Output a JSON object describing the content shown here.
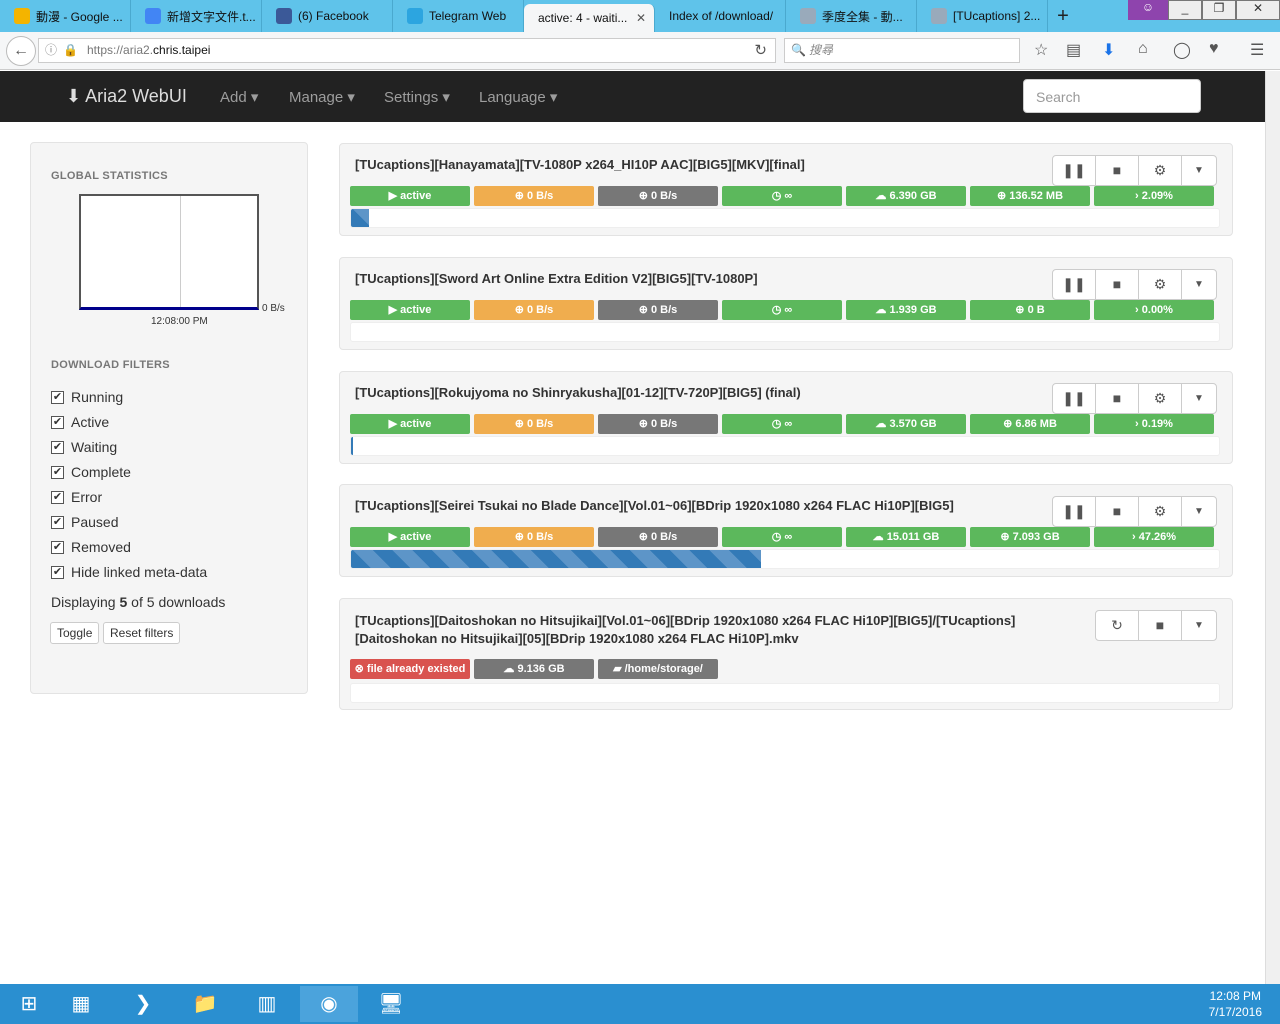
{
  "browser": {
    "tabs": [
      {
        "label": "動漫 - Google ...",
        "color": "#f4b400"
      },
      {
        "label": "新增文字文件.t...",
        "color": "#4285f4"
      },
      {
        "label": "(6) Facebook",
        "color": "#3b5998"
      },
      {
        "label": "Telegram Web",
        "color": "#2ca5e0"
      },
      {
        "label": "active: 4 - waiti...",
        "color": ""
      },
      {
        "label": "Index of /download/",
        "color": ""
      },
      {
        "label": "季度全集 - 動...",
        "color": "#9ab"
      },
      {
        "label": "[TUcaptions] 2...",
        "color": "#9ab"
      }
    ],
    "url_prefix": "https://aria2.",
    "url_domain": "chris.taipei",
    "search_placeholder": "搜尋"
  },
  "nav": {
    "brand": "Aria2 WebUI",
    "menus": [
      "Add",
      "Manage",
      "Settings",
      "Language"
    ],
    "search_placeholder": "Search"
  },
  "sidebar": {
    "stats_title": "GLOBAL STATISTICS",
    "graph_speed": "0 B/s",
    "graph_time": "12:08:00 PM",
    "filters_title": "DOWNLOAD FILTERS",
    "filters": [
      "Running",
      "Active",
      "Waiting",
      "Complete",
      "Error",
      "Paused",
      "Removed",
      "Hide linked meta-data"
    ],
    "display_pre": "Displaying",
    "display_count": "5",
    "display_mid": "of",
    "display_total": "5",
    "display_post": "downloads",
    "toggle": "Toggle",
    "reset": "Reset filters"
  },
  "downloads": [
    {
      "name": "[TUcaptions][Hanayamata][TV-1080P x264_HI10P AAC][BIG5][MKV][final]",
      "status": "active",
      "down": "0 B/s",
      "up": "0 B/s",
      "eta": "∞",
      "size": "6.390 GB",
      "downloaded": "136.52 MB",
      "percent": "2.09%",
      "progress": 2.09
    },
    {
      "name": "[TUcaptions][Sword Art Online Extra Edition V2][BIG5][TV-1080P]",
      "status": "active",
      "down": "0 B/s",
      "up": "0 B/s",
      "eta": "∞",
      "size": "1.939 GB",
      "downloaded": "0 B",
      "percent": "0.00%",
      "progress": 0
    },
    {
      "name": "[TUcaptions][Rokujyoma no Shinryakusha][01-12][TV-720P][BIG5] (final)",
      "status": "active",
      "down": "0 B/s",
      "up": "0 B/s",
      "eta": "∞",
      "size": "3.570 GB",
      "downloaded": "6.86 MB",
      "percent": "0.19%",
      "progress": 0.19
    },
    {
      "name": "[TUcaptions][Seirei Tsukai no Blade Dance][Vol.01~06][BDrip 1920x1080 x264 FLAC Hi10P][BIG5]",
      "status": "active",
      "down": "0 B/s",
      "up": "0 B/s",
      "eta": "∞",
      "size": "15.011 GB",
      "downloaded": "7.093 GB",
      "percent": "47.26%",
      "progress": 47.26
    }
  ],
  "error_download": {
    "name": "[TUcaptions][Daitoshokan no Hitsujikai][Vol.01~06][BDrip 1920x1080 x264 FLAC Hi10P][BIG5]/[TUcaptions][Daitoshokan no Hitsujikai][05][BDrip 1920x1080 x264 FLAC Hi10P].mkv",
    "status": "file already existed",
    "size": "9.136 GB",
    "path": "/home/storage/"
  },
  "taskbar": {
    "time": "12:08 PM",
    "date": "7/17/2016"
  }
}
